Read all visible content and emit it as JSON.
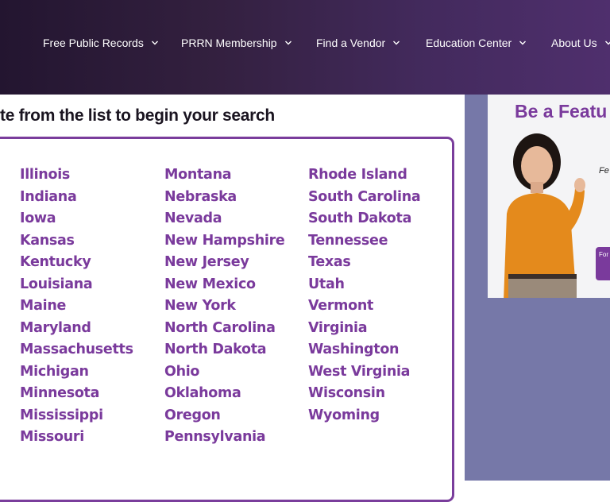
{
  "nav": {
    "items": [
      {
        "label": "Free Public Records"
      },
      {
        "label": "PRRN Membership"
      },
      {
        "label": "Find a Vendor"
      },
      {
        "label": "Education Center"
      },
      {
        "label": "About Us"
      }
    ]
  },
  "main": {
    "heading": "te from the list to begin your search",
    "columns": [
      [
        "Illinois",
        "Indiana",
        "Iowa",
        "Kansas",
        "Kentucky",
        "Louisiana",
        "Maine",
        "Maryland",
        "Massachusetts",
        "Michigan",
        "Minnesota",
        "Mississippi",
        "Missouri"
      ],
      [
        "Montana",
        "Nebraska",
        "Nevada",
        "New Hampshire",
        "New Jersey",
        "New Mexico",
        "New York",
        "North Carolina",
        "North Dakota",
        "Ohio",
        "Oklahoma",
        "Oregon",
        "Pennsylvania"
      ],
      [
        "Rhode Island",
        "South Carolina",
        "South Dakota",
        "Tennessee",
        "Texas",
        "Utah",
        "Vermont",
        "Virginia",
        "Washington",
        "West Virginia",
        "Wisconsin",
        "Wyoming"
      ]
    ]
  },
  "ad": {
    "title": "Be a Featu",
    "text": "Fe se of",
    "button": "For spo"
  },
  "colors": {
    "accent": "#7a3a9c",
    "sidebar": "#7678a8"
  }
}
